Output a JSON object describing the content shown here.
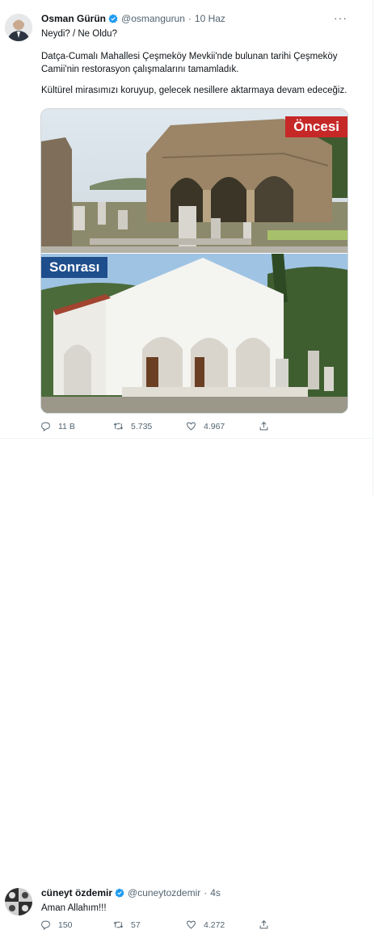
{
  "tweet": {
    "author_name": "Osman Gürün",
    "handle": "@osmangurun",
    "separator": "·",
    "time": "10 Haz",
    "more": "···",
    "line1": "Neydi? / Ne Oldu?",
    "line2": "Datça-Cumalı Mahallesi Çeşmeköy Mevkii'nde bulunan tarihi Çeşmeköy Camii'nin restorasyon çalışmalarını tamamladık.",
    "line3": "Kültürel mirasımızı koruyup, gelecek nesillere aktarmaya devam edeceğiz.",
    "media": {
      "label_before": "Öncesi",
      "label_after": "Sonrası"
    },
    "replies": "11 B",
    "retweets": "5.735",
    "likes": "4.967"
  },
  "reply": {
    "author_name": "cüneyt özdemir",
    "handle": "@cuneytozdemir",
    "separator": "·",
    "time": "4s",
    "text": "Aman Allahım!!!",
    "replies": "150",
    "retweets": "57",
    "likes": "4.272"
  },
  "colors": {
    "verified": "#1d9bf0",
    "label_before_bg": "#c62828",
    "label_after_bg": "#1f4e8c",
    "muted": "#536471"
  }
}
